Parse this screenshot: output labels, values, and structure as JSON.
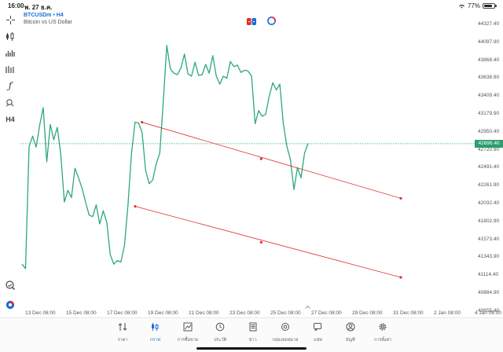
{
  "status_bar": {
    "time": "16:00",
    "date": "พ. 27 ธ.ค.",
    "battery": "77%"
  },
  "symbol": {
    "name": "BTCUSDm • H4",
    "description": "Bitcoin vs US Dollar"
  },
  "left_toolbar": {
    "timeframe": "H4"
  },
  "price_axis": {
    "labels": [
      "44327.40",
      "44097.90",
      "43868.40",
      "43638.90",
      "43409.40",
      "43179.90",
      "42950.40",
      "42720.90",
      "42491.40",
      "42261.90",
      "42032.40",
      "41802.90",
      "41573.40",
      "41343.90",
      "41114.40",
      "40884.90",
      "40655.40"
    ],
    "current_price": "42696.40"
  },
  "time_axis": {
    "labels": [
      "13 Dec 08:00",
      "15 Dec 08:00",
      "17 Dec 08:00",
      "19 Dec 08:00",
      "21 Dec 08:00",
      "23 Dec 08:00",
      "25 Dec 08:00",
      "27 Dec 08:00",
      "29 Dec 08:00",
      "31 Dec 08:00",
      "2 Jan 08:00",
      "4 Jan 08:00"
    ]
  },
  "chart_data": {
    "type": "line",
    "symbol": "BTCUSDm",
    "timeframe": "H4",
    "series": [
      {
        "values": [
          41050,
          40990,
          42660,
          42800,
          42650,
          42950,
          43190,
          42450,
          42960,
          42750,
          42920,
          42540,
          41900,
          42060,
          41960,
          42360,
          42230,
          42090,
          41900,
          41720,
          41700,
          41860,
          41600,
          41780,
          41620,
          41180,
          41050,
          41100,
          41080,
          41300,
          41850,
          42560,
          42990,
          42980,
          42850,
          42330,
          42150,
          42200,
          42420,
          42570,
          43280,
          44040,
          43720,
          43660,
          43640,
          43730,
          43920,
          43650,
          43620,
          43810,
          43630,
          43640,
          43780,
          43660,
          43900,
          43620,
          43510,
          43620,
          43590,
          43820,
          43750,
          43770,
          43670,
          43700,
          43690,
          43620,
          42970,
          43150,
          43070,
          43100,
          43350,
          43530,
          43430,
          43510,
          42970,
          42660,
          42480,
          42070,
          42370,
          42230,
          42570,
          42700
        ]
      }
    ],
    "trendlines": [
      {
        "start": {
          "date": "18 Dec 16:00",
          "price": 42990
        },
        "mid": {
          "date": "24 Dec 12:00",
          "price": 42490
        },
        "end": {
          "date": "31 Dec 08:00",
          "price": 41950
        }
      },
      {
        "start": {
          "date": "18 Dec 08:00",
          "price": 41840
        },
        "mid": {
          "date": "24 Dec 12:00",
          "price": 41350
        },
        "end": {
          "date": "31 Dec 08:00",
          "price": 40870
        }
      }
    ],
    "current_price": 42696.4,
    "ylim": [
      40655.4,
      44327.4
    ]
  },
  "nav": [
    {
      "label": "ราคา",
      "icon": "quotes-icon"
    },
    {
      "label": "กราฟ",
      "icon": "chart-icon",
      "active": true
    },
    {
      "label": "การซื้อขาย",
      "icon": "trade-icon"
    },
    {
      "label": "ประวัติ",
      "icon": "history-icon"
    },
    {
      "label": "ข่าว",
      "icon": "news-icon"
    },
    {
      "label": "กล่องจดหมาย",
      "icon": "mailbox-icon"
    },
    {
      "label": "แชท",
      "icon": "chat-icon"
    },
    {
      "label": "บัญชี",
      "icon": "account-icon"
    },
    {
      "label": "การตั้งค่า",
      "icon": "settings-icon"
    }
  ],
  "colors": {
    "line": "#2ca87a",
    "trendline": "#e22b2b",
    "accent": "#1a6fd8",
    "current_price_bg": "#2e9d70"
  }
}
